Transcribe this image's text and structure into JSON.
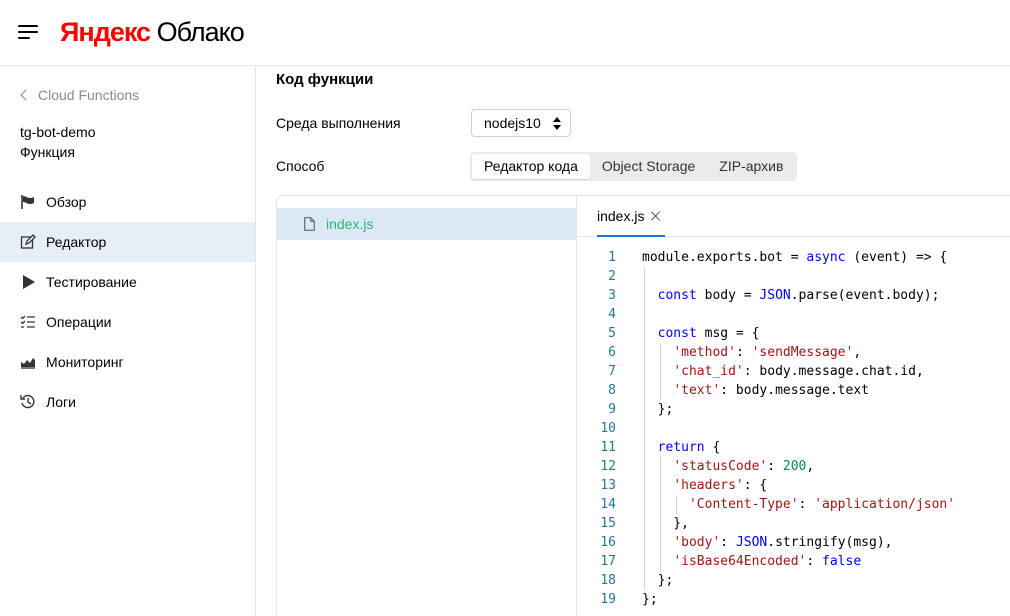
{
  "header": {
    "menu_icon": "hamburger-menu-icon",
    "logo_brand": "Яндекс",
    "logo_product": "Облако",
    "logo_brand_color": "#ff0000"
  },
  "sidebar": {
    "back_label": "Cloud Functions",
    "function_name": "tg-bot-demo",
    "function_type": "Функция",
    "items": [
      {
        "label": "Обзор",
        "icon": "flag-icon",
        "active": false
      },
      {
        "label": "Редактор",
        "icon": "edit-icon",
        "active": true
      },
      {
        "label": "Тестирование",
        "icon": "play-icon",
        "active": false
      },
      {
        "label": "Операции",
        "icon": "checklist-icon",
        "active": false
      },
      {
        "label": "Мониторинг",
        "icon": "chart-icon",
        "active": false
      },
      {
        "label": "Логи",
        "icon": "history-icon",
        "active": false
      }
    ],
    "active_color": "#e6eef8"
  },
  "main": {
    "title": "Код функции",
    "runtime_label": "Среда выполнения",
    "runtime_value": "nodejs10",
    "method_label": "Способ",
    "method_options": [
      "Редактор кода",
      "Object Storage",
      "ZIP-архив"
    ],
    "method_selected": "Редактор кода",
    "files": [
      {
        "name": "index.js",
        "icon": "file-icon",
        "color": "#2bb673"
      }
    ],
    "open_tab": "index.js",
    "code_lines": [
      "module.exports.bot = async (event) => {",
      "",
      "  const body = JSON.parse(event.body);",
      "",
      "  const msg = {",
      "    'method': 'sendMessage',",
      "    'chat_id': body.message.chat.id,",
      "    'text': body.message.text",
      "  };",
      "",
      "  return {",
      "    'statusCode': 200,",
      "    'headers': {",
      "      'Content-Type': 'application/json'",
      "    },",
      "    'body': JSON.stringify(msg),",
      "    'isBase64Encoded': false",
      "  };",
      "};"
    ]
  }
}
